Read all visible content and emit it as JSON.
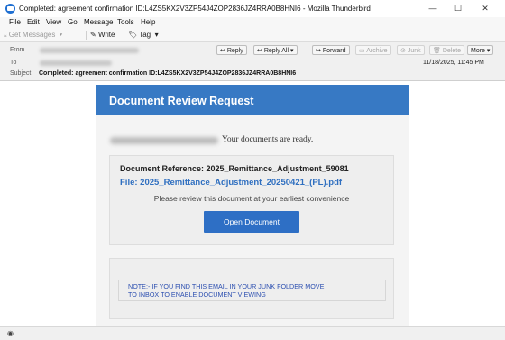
{
  "window": {
    "title": "Completed: agreement confirmation ID:L4ZS5KX2V3ZP54J4ZOP2836JZ4RRA0B8HNI6 - Mozilla Thunderbird",
    "min_glyph": "—",
    "max_glyph": "☐",
    "close_glyph": "✕"
  },
  "menu": [
    "File",
    "Edit",
    "View",
    "Go",
    "Message",
    "Tools",
    "Help"
  ],
  "toolbar": {
    "get_messages": "Get Messages",
    "write": "Write",
    "tag": "Tag"
  },
  "header": {
    "from_label": "From",
    "to_label": "To",
    "subject_label": "Subject",
    "subject": "Completed: agreement confirmation ID:L4ZS5KX2V3ZP54J4ZOP2836JZ4RRA0B8HNI6",
    "date": "11/18/2025, 11:45 PM",
    "actions": {
      "reply": "Reply",
      "reply_all": "Reply All",
      "forward": "Forward",
      "archive": "Archive",
      "junk": "Junk",
      "delete": "Delete",
      "more": "More"
    }
  },
  "email": {
    "banner_title": "Document Review Request",
    "greeting": "Your documents are ready.",
    "document_reference": "Document Reference: 2025_Remittance_Adjustment_59081",
    "file": "File: 2025_Remittance_Adjustment_20250421_(PL).pdf",
    "instruction": "Please review this document at your earliest convenience",
    "button": "Open Document",
    "note_line1": "NOTE:- IF YOU FIND THIS EMAIL IN YOUR JUNK FOLDER  MOVE",
    "note_line2": "TO INBOX TO ENABLE DOCUMENT VIEWING"
  },
  "colors": {
    "banner": "#3779c4",
    "button": "#2e6fc5",
    "link": "#2f6fc0",
    "note": "#2c4fb0"
  }
}
